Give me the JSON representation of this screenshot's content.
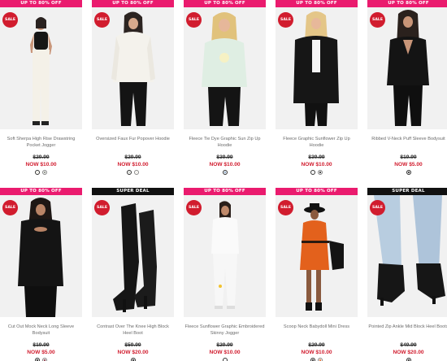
{
  "colors": {
    "accent_pink": "#ea1b6e",
    "sale_red": "#d11c2e",
    "price_text": "#333333"
  },
  "products": [
    {
      "banner": "UP TO 80% OFF",
      "banner_style": "pink",
      "badge": "SALE",
      "name": "Soft Sherpa High Rise Drawstring Pocket Jogger",
      "was": "$29.99",
      "now": "NOW $10.00",
      "swatches": [
        "#f1efe4",
        "#7a7f73"
      ]
    },
    {
      "banner": "UP TO 80% OFF",
      "banner_style": "pink",
      "badge": "SALE",
      "name": "Oversized Faux Fur Popover Hoodie",
      "was": "$29.99",
      "now": "NOW $10.00",
      "swatches": [
        "#c7cbc3",
        "#f3efe5"
      ]
    },
    {
      "banner": "UP TO 80% OFF",
      "banner_style": "pink",
      "badge": "SALE",
      "name": "Fleece Tie Dye Graphic Sun Zip Up Hoodie",
      "was": "$39.99",
      "now": "NOW $10.00",
      "swatches": [
        "#7b9bbf"
      ]
    },
    {
      "banner": "UP TO 80% OFF",
      "banner_style": "pink",
      "badge": "SALE",
      "name": "Fleece Graphic Sunflower Zip Up Hoodie",
      "was": "$39.99",
      "now": "NOW $10.00",
      "swatches": [
        "#f2f2f2",
        "#111111"
      ]
    },
    {
      "banner": "UP TO 80% OFF",
      "banner_style": "pink",
      "badge": "SALE",
      "name": "Ribbed V-Neck Puff Sleeve Bodysuit",
      "was": "$19.99",
      "now": "NOW $5.00",
      "swatches": [
        "#111111"
      ]
    },
    {
      "banner": "UP TO 80% OFF",
      "banner_style": "pink",
      "badge": "SALE",
      "name": "Cut Out Mock Neck Long Sleeve Bodysuit",
      "was": "$19.99",
      "now": "NOW $5.00",
      "swatches": [
        "#111111",
        "#7a2030"
      ]
    },
    {
      "banner": "SUPER DEAL",
      "banner_style": "black",
      "badge": "SALE",
      "name": "Contrast Over The Knee High Block Heel Boot",
      "was": "$59.99",
      "now": "NOW $20.00",
      "swatches": [
        "#111111"
      ]
    },
    {
      "banner": "UP TO 80% OFF",
      "banner_style": "pink",
      "badge": "SALE",
      "name": "Fleece Sunflower Graphic Embroidered Skinny Jogger",
      "was": "$29.99",
      "now": "NOW $10.00",
      "swatches": [
        "#f2f2f2"
      ]
    },
    {
      "banner": "UP TO 80% OFF",
      "banner_style": "pink",
      "badge": "SALE",
      "name": "Scoop Neck Babydoll Mini Dress",
      "was": "$29.99",
      "now": "NOW $10.00",
      "swatches": [
        "#111111",
        "#e3611c"
      ]
    },
    {
      "banner": "SUPER DEAL",
      "banner_style": "black",
      "badge": "SALE",
      "name": "Pointed Zip Ankle Mid Block Heel Boots",
      "was": "$49.99",
      "now": "NOW $20.00",
      "swatches": [
        "#111111"
      ]
    }
  ]
}
